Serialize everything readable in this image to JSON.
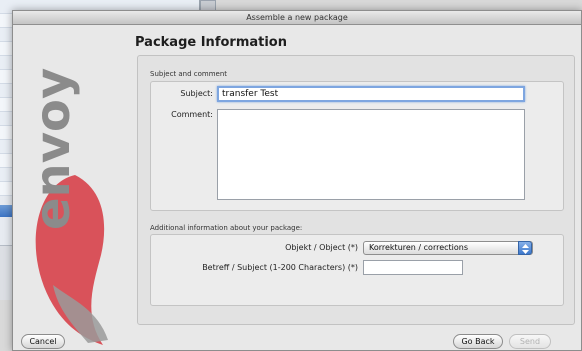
{
  "window": {
    "title": "Assemble a new package"
  },
  "heading": "Package Information",
  "subject_section": {
    "legend": "Subject and comment",
    "subject_label": "Subject:",
    "subject_value": "transfer Test",
    "comment_label": "Comment:",
    "comment_value": ""
  },
  "additional_section": {
    "legend": "Additional information about your package:",
    "objekt_label": "Objekt / Object (*)",
    "objekt_value": "Korrekturen / corrections",
    "betreff_label": "Betreff / Subject (1-200 Characters) (*)",
    "betreff_value": ""
  },
  "buttons": {
    "cancel": "Cancel",
    "go_back": "Go Back",
    "send": "Send"
  },
  "logo": {
    "text": "envoy"
  },
  "colors": {
    "accent": "#3d78cc",
    "logo_red": "#d9525a",
    "logo_grey": "#9a9a9a"
  }
}
